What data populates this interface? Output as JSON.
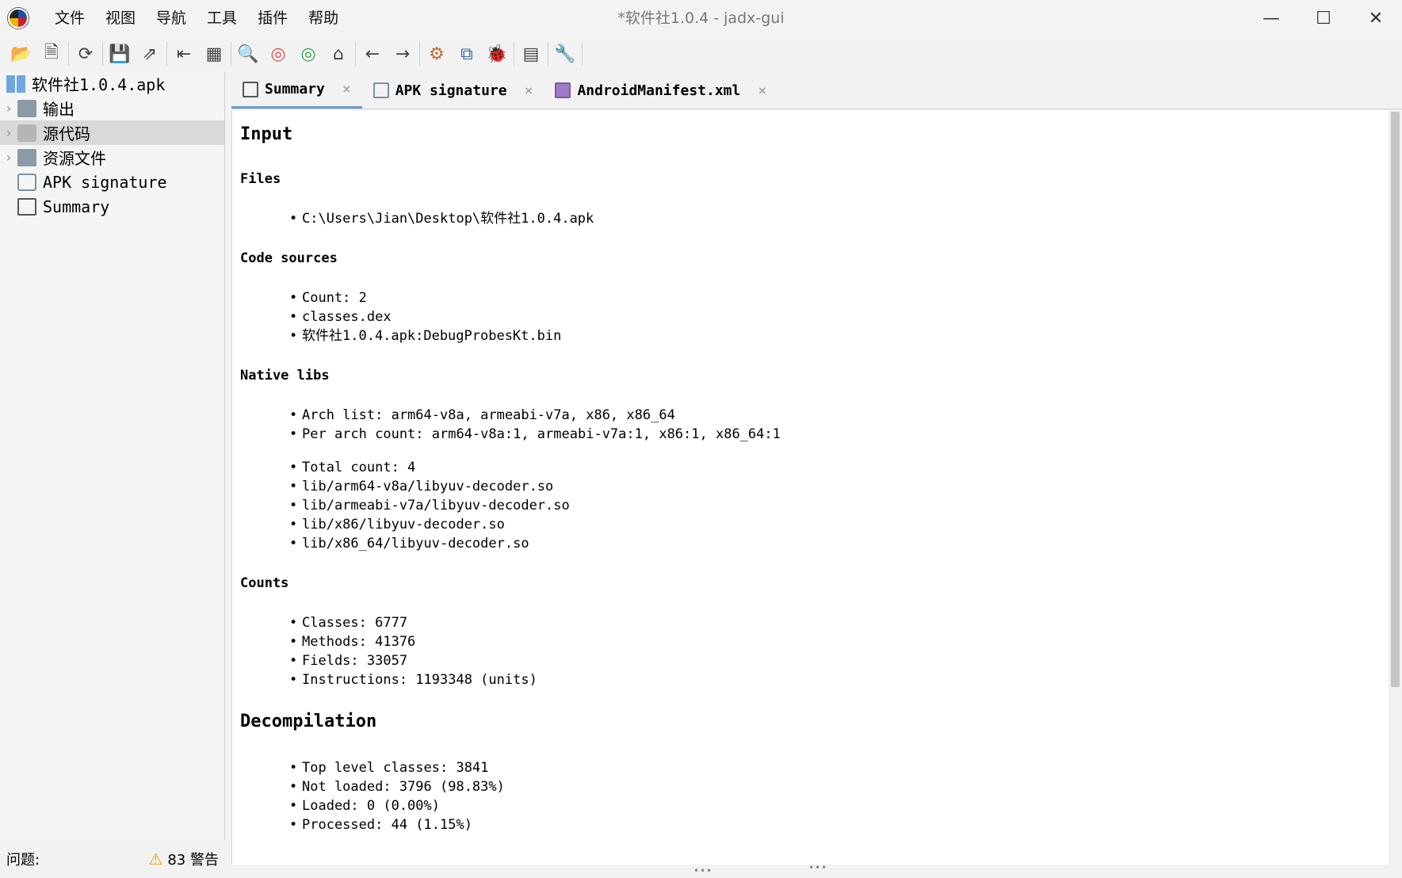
{
  "window": {
    "title": "*软件社1.0.4 - jadx-gui",
    "menu": [
      "文件",
      "视图",
      "导航",
      "工具",
      "插件",
      "帮助"
    ]
  },
  "toolbar": {
    "icons": [
      "open-folder-icon",
      "add-file-icon",
      "refresh-icon",
      "save-icon",
      "export-icon",
      "sync-tree-icon",
      "flatten-packages-icon",
      "search-icon",
      "find-usage-icon",
      "find-class-icon",
      "home-icon",
      "back-icon",
      "forward-icon",
      "deobfuscation-icon",
      "quick-tabs-icon",
      "debug-icon",
      "log-icon",
      "preferences-icon"
    ]
  },
  "tree": {
    "root": "软件社1.0.4.apk",
    "items": [
      {
        "label": "输出",
        "icon": "folder-icon"
      },
      {
        "label": "源代码",
        "icon": "source-icon"
      },
      {
        "label": "资源文件",
        "icon": "resources-icon"
      },
      {
        "label": "APK signature",
        "icon": "signature-icon"
      },
      {
        "label": "Summary",
        "icon": "summary-icon"
      }
    ]
  },
  "status": {
    "problems_label": "问题:",
    "warnings": "83 警告"
  },
  "tabs": [
    {
      "label": "Summary",
      "icon": "summary-icon"
    },
    {
      "label": "APK signature",
      "icon": "signature-icon"
    },
    {
      "label": "AndroidManifest.xml",
      "icon": "manifest-icon"
    }
  ],
  "content": {
    "input_title": "Input",
    "files_title": "Files",
    "files": [
      "C:\\Users\\Jian\\Desktop\\软件社1.0.4.apk"
    ],
    "code_sources_title": "Code sources",
    "code_sources": [
      "Count: 2",
      "classes.dex",
      "软件社1.0.4.apk:DebugProbesKt.bin"
    ],
    "native_libs_title": "Native libs",
    "native_libs_a": [
      "Arch list: arm64-v8a, armeabi-v7a, x86, x86_64",
      "Per arch count: arm64-v8a:1, armeabi-v7a:1, x86:1, x86_64:1"
    ],
    "native_libs_b": [
      "Total count: 4",
      "lib/arm64-v8a/libyuv-decoder.so",
      "lib/armeabi-v7a/libyuv-decoder.so",
      "lib/x86/libyuv-decoder.so",
      "lib/x86_64/libyuv-decoder.so"
    ],
    "counts_title": "Counts",
    "counts": [
      "Classes: 6777",
      "Methods: 41376",
      "Fields: 33057",
      "Instructions: 1193348 (units)"
    ],
    "decompilation_title": "Decompilation",
    "decompilation": [
      "Top level classes: 3841",
      "Not loaded: 3796 (98.83%)",
      "Loaded: 0 (0.00%)",
      "Processed: 44 (1.15%)"
    ]
  }
}
